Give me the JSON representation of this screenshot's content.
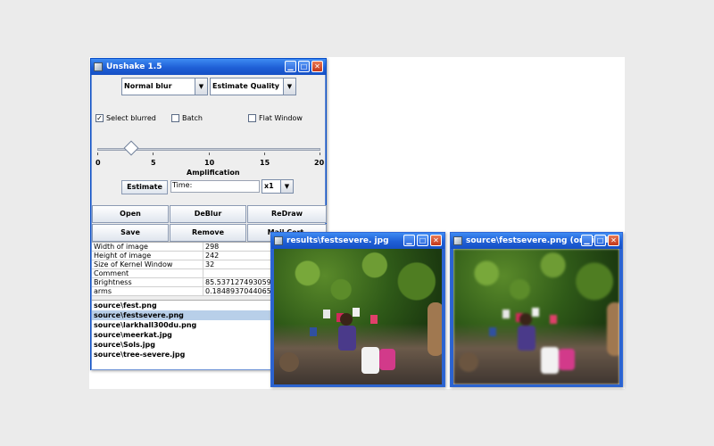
{
  "main_window": {
    "title": "Unshake 1.5",
    "blur_select": "Normal blur",
    "quality_select": "Estimate Quality",
    "checkboxes": [
      {
        "label": "Select blurred",
        "checked": true
      },
      {
        "label": "Batch",
        "checked": false
      },
      {
        "label": "Flat Window",
        "checked": false
      }
    ],
    "slider": {
      "ticks": [
        "0",
        "5",
        "10",
        "15",
        "20"
      ],
      "label": "Amplification",
      "value": 3
    },
    "estimate_button": "Estimate",
    "time_label": "Time:",
    "multiplier_select": "x1",
    "buttons_row1": [
      "Open",
      "DeBlur",
      "ReDraw"
    ],
    "buttons_row2": [
      "Save",
      "Remove",
      "Mail Cert."
    ],
    "properties": [
      {
        "key": "Width of image",
        "value": "298"
      },
      {
        "key": "Height of image",
        "value": "242"
      },
      {
        "key": "Size of Kernel Window",
        "value": "32"
      },
      {
        "key": "Comment",
        "value": ""
      },
      {
        "key": "Brightness",
        "value": "85.53712749305953"
      },
      {
        "key": "arms",
        "value": "0.1848937044065975"
      }
    ],
    "files": [
      {
        "name": "source\\fest.png",
        "selected": false
      },
      {
        "name": "source\\festsevere.png",
        "selected": true
      },
      {
        "name": "source\\larkhall300du.png",
        "selected": false
      },
      {
        "name": "source\\meerkat.jpg",
        "selected": false
      },
      {
        "name": "source\\Sols.jpg",
        "selected": false
      },
      {
        "name": "source\\tree-severe.jpg",
        "selected": false
      }
    ]
  },
  "result_window": {
    "title": "results\\festsevere. jpg"
  },
  "original_window": {
    "title": "source\\festsevere.png (original)"
  },
  "titlebar_buttons": {
    "minimize": "▁",
    "maximize": "□",
    "close": "✕"
  },
  "colors": {
    "titlebar": "#1f5fd6",
    "selection": "#b8cfe9",
    "close_button": "#c2361a"
  }
}
